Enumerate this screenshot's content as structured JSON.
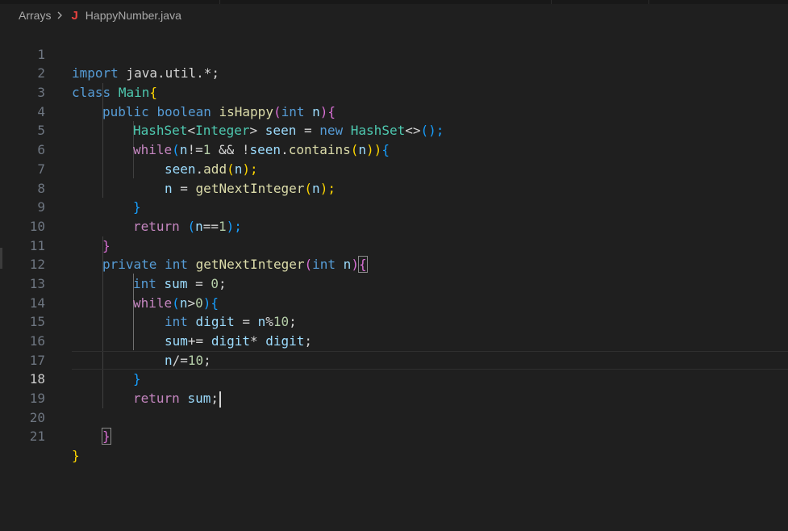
{
  "breadcrumb": {
    "folder": "Arrays",
    "file": "HappyNumber.java",
    "file_icon": "J",
    "file_icon_color": "#e8423f"
  },
  "editor": {
    "current_line": 18,
    "line_numbers": [
      "1",
      "2",
      "3",
      "4",
      "5",
      "6",
      "7",
      "8",
      "9",
      "10",
      "11",
      "12",
      "13",
      "14",
      "15",
      "16",
      "17",
      "18",
      "19",
      "20",
      "21"
    ]
  },
  "code": {
    "l1": [
      "import",
      " java.util.*;"
    ],
    "l2": [
      "class",
      " ",
      "Main",
      "{"
    ],
    "l3": [
      "public",
      " ",
      "boolean",
      " ",
      "isHappy",
      "(",
      "int",
      " ",
      "n",
      "){"
    ],
    "l4": [
      "HashSet",
      "<",
      "Integer",
      ">",
      " ",
      "seen",
      " = ",
      "new",
      " ",
      "HashSet",
      "<>",
      "(",
      ");"
    ],
    "l5": [
      "while",
      "(",
      "n",
      "!=",
      "1",
      " && !",
      "seen",
      ".",
      "contains",
      "(",
      "n",
      "))",
      "{"
    ],
    "l6": [
      "seen",
      ".",
      "add",
      "(",
      "n",
      ");"
    ],
    "l7": [
      "n",
      " = ",
      "getNextInteger",
      "(",
      "n",
      ");"
    ],
    "l8": [
      "}"
    ],
    "l9": [
      "return",
      " ",
      "(",
      "n",
      "==",
      "1",
      ");"
    ],
    "l10": [
      "}"
    ],
    "l11": [
      "private",
      " ",
      "int",
      " ",
      "getNextInteger",
      "(",
      "int",
      " ",
      "n",
      ")",
      "{"
    ],
    "l12": [
      "int",
      " ",
      "sum",
      " = ",
      "0",
      ";"
    ],
    "l13": [
      "while",
      "(",
      "n",
      ">",
      "0",
      ")",
      "{"
    ],
    "l14": [
      "int",
      " ",
      "digit",
      " = ",
      "n",
      "%",
      "10",
      ";"
    ],
    "l15": [
      "sum",
      "+= ",
      "digit",
      "* ",
      "digit",
      ";"
    ],
    "l16": [
      "n",
      "/=",
      "10",
      ";"
    ],
    "l17": [
      "}"
    ],
    "l18": [
      "return",
      " ",
      "sum",
      ";"
    ],
    "l19": [],
    "l20": [
      "}"
    ],
    "l21": [
      "}"
    ]
  },
  "colors": {
    "background": "#1f1f1f",
    "keyword": "#569cd6",
    "control": "#c586c0",
    "type": "#4ec9b0",
    "function": "#dcdcaa",
    "variable": "#9cdcfe",
    "number": "#b5cea8",
    "bracket_level1": "#ffd700",
    "bracket_level2": "#da70d6",
    "bracket_level3": "#179fff"
  }
}
